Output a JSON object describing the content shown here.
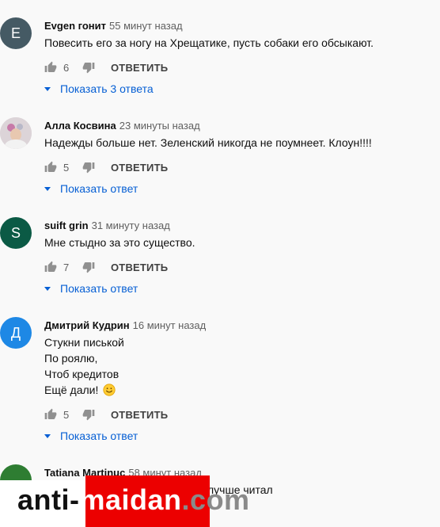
{
  "comments": [
    {
      "author": "Evgen гонит",
      "time": "55 минут назад",
      "avatar_letter": "E",
      "avatar_color": "#455a64",
      "text_lines": [
        "Повесить его за ногу на Хрещатике, пусть собаки его обсыкают."
      ],
      "likes": "6",
      "reply_label": "ОТВЕТИТЬ",
      "show_replies": "Показать 3 ответа"
    },
    {
      "author": "Алла Косвина",
      "time": "23 минуты назад",
      "avatar_letter": "",
      "avatar_color": "#d9d2d6",
      "text_lines": [
        "Надежды больше нет. Зеленский никогда не поумнеет. Клоун!!!!"
      ],
      "likes": "5",
      "reply_label": "ОТВЕТИТЬ",
      "show_replies": "Показать ответ"
    },
    {
      "author": "suift grin",
      "time": "31 минуту назад",
      "avatar_letter": "S",
      "avatar_color": "#0b5a45",
      "text_lines": [
        "Мне стыдно за это существо."
      ],
      "likes": "7",
      "reply_label": "ОТВЕТИТЬ",
      "show_replies": "Показать ответ"
    },
    {
      "author": "Дмитрий Кудрин",
      "time": "16 минут назад",
      "avatar_letter": "Д",
      "avatar_color": "#1e88e5",
      "text_lines": [
        "Стукни писькой",
        "По роялю,",
        "Чтоб кредитов",
        "Ещё дали!"
      ],
      "likes": "5",
      "reply_label": "ОТВЕТИТЬ",
      "show_replies": "Показать ответ"
    },
    {
      "author": "Tatiana Martinuc",
      "time": "58 минут назад",
      "avatar_color": "#2e7d32",
      "text_partial": "лучше читал"
    }
  ],
  "watermark": {
    "part1": "anti-",
    "part2": "maidan",
    "part3": ".com"
  },
  "icons": [
    "thumb-up-icon",
    "thumb-down-icon",
    "caret-down-icon",
    "smile-emoji-icon"
  ]
}
